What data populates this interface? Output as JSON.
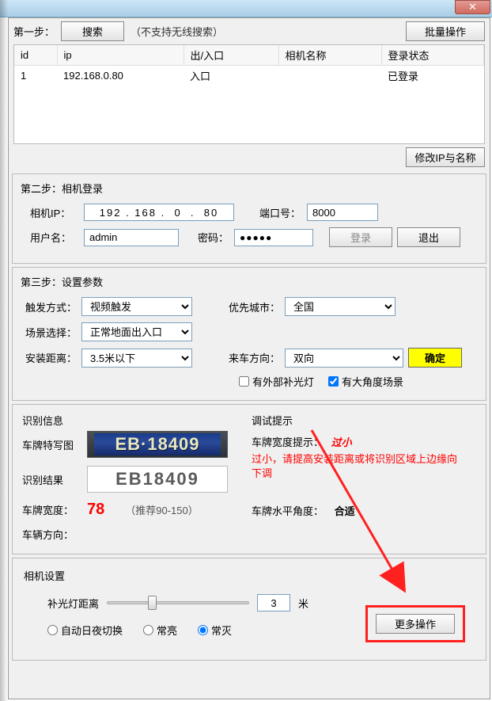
{
  "step1": {
    "label": "第一步：",
    "search_btn": "搜索",
    "note": "（不支持无线搜索）",
    "batch_btn": "批量操作",
    "modify_btn": "修改IP与名称",
    "table": {
      "headers": [
        "id",
        "ip",
        "出/入口",
        "相机名称",
        "登录状态"
      ],
      "rows": [
        {
          "id": "1",
          "ip": "192.168.0.80",
          "gate": "入口",
          "name": "",
          "status": "已登录"
        }
      ]
    }
  },
  "step2": {
    "title": "第二步：相机登录",
    "camera_ip_label": "相机IP：",
    "camera_ip": "192 . 168 .  0  .  80",
    "port_label": "端口号：",
    "port": "8000",
    "user_label": "用户名：",
    "user": "admin",
    "pwd_label": "密码：",
    "pwd_mask": "●●●●●",
    "login_btn": "登录",
    "logout_btn": "退出"
  },
  "step3": {
    "title": "第三步：设置参数",
    "trigger_label": "触发方式：",
    "trigger_value": "视频触发",
    "city_label": "优先城市：",
    "city_value": "全国",
    "scene_label": "场景选择：",
    "scene_value": "正常地面出入口",
    "distance_label": "安装距离：",
    "distance_value": "3.5米以下",
    "direction_label": "来车方向：",
    "direction_value": "双向",
    "confirm_btn": "确定",
    "external_light": "有外部补光灯",
    "large_angle": "有大角度场景"
  },
  "recognition": {
    "info_title": "识别信息",
    "plate_img_label": "车牌特写图",
    "plate_img_text": "EB·18409",
    "result_label": "识别结果",
    "result_value": "EB18409",
    "width_label": "车牌宽度：",
    "width_value": "78",
    "width_hint": "（推荐90-150）",
    "vehicle_dir_label": "车辆方向：",
    "debug_title": "调试提示",
    "plate_width_hint_label": "车牌宽度提示：",
    "plate_width_hint_value": "过小",
    "plate_width_para": "过小，请提高安装距离或将识别区域上边缘向下调",
    "angle_label": "车牌水平角度：",
    "angle_value": "合适"
  },
  "camera": {
    "title": "相机设置",
    "light_dist_label": "补光灯距离",
    "light_dist_value": "3",
    "unit": "米",
    "radio_auto": "自动日夜切换",
    "radio_on": "常亮",
    "radio_off": "常灭",
    "more_btn": "更多操作"
  }
}
